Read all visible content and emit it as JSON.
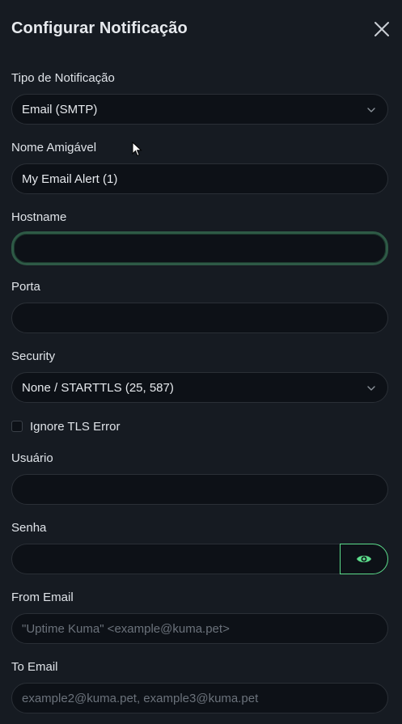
{
  "modal": {
    "title": "Configurar Notificação"
  },
  "fields": {
    "notification_type": {
      "label": "Tipo de Notificação",
      "value": "Email (SMTP)"
    },
    "friendly_name": {
      "label": "Nome Amigável",
      "value": "My Email Alert (1)"
    },
    "hostname": {
      "label": "Hostname",
      "value": ""
    },
    "port": {
      "label": "Porta",
      "value": ""
    },
    "security": {
      "label": "Security",
      "value": "None / STARTTLS (25, 587)"
    },
    "ignore_tls": {
      "label": "Ignore TLS Error",
      "checked": false
    },
    "username": {
      "label": "Usuário",
      "value": ""
    },
    "password": {
      "label": "Senha",
      "value": ""
    },
    "from_email": {
      "label": "From Email",
      "placeholder": "\"Uptime Kuma\" <example@kuma.pet>"
    },
    "to_email": {
      "label": "To Email",
      "placeholder": "example2@kuma.pet, example3@kuma.pet"
    }
  },
  "icons": {
    "close": "close-icon",
    "chevron": "chevron-down-icon",
    "eye": "eye-icon"
  },
  "colors": {
    "background": "#161b22",
    "input_background": "#0d1117",
    "accent": "#5cdd8b",
    "focus_border": "#2e5a46"
  }
}
